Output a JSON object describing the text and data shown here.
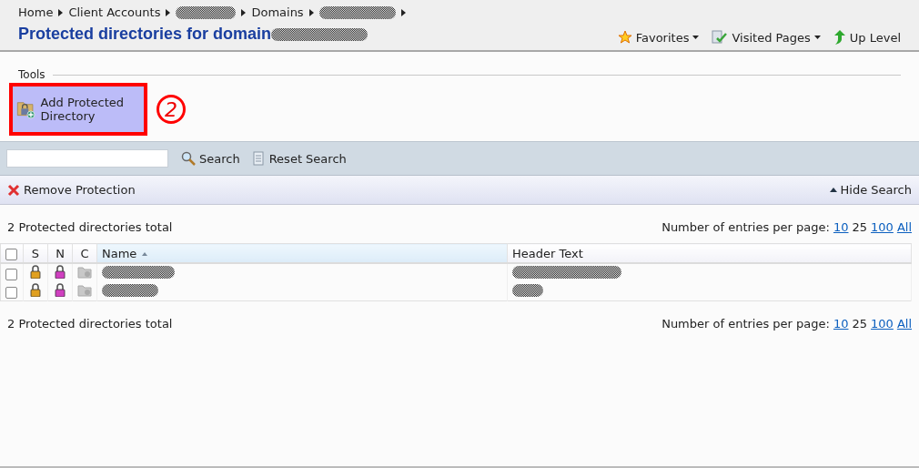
{
  "breadcrumb": [
    {
      "kind": "link",
      "label": "Home"
    },
    {
      "kind": "link",
      "label": "Client Accounts"
    },
    {
      "kind": "redacted"
    },
    {
      "kind": "link",
      "label": "Domains"
    },
    {
      "kind": "redacted"
    }
  ],
  "page_title": "Protected directories for domain",
  "top_links": [
    {
      "label": "Favorites",
      "dropdown": true
    },
    {
      "label": "Visited Pages",
      "dropdown": true
    },
    {
      "label": "Up Level",
      "dropdown": false
    }
  ],
  "tools": {
    "title": "Tools",
    "buttons": [
      {
        "label": "Add Protected Directory",
        "highlighted": true
      }
    ]
  },
  "annotation": {
    "number": "2"
  },
  "search": {
    "buttons": [
      {
        "label": "Search"
      },
      {
        "label": "Reset Search"
      }
    ]
  },
  "actions": {
    "left": [
      {
        "label": "Remove Protection"
      }
    ],
    "right": [
      {
        "label": "Hide Search"
      }
    ]
  },
  "summary": "2 Protected directories total",
  "per_page": {
    "label": "Number of entries per page:",
    "options": [
      {
        "label": "10",
        "selected": false
      },
      {
        "label": "25",
        "selected": true
      },
      {
        "label": "100",
        "selected": false
      },
      {
        "label": "All",
        "selected": false
      }
    ]
  },
  "table": {
    "select_all_checked": false,
    "columns": [
      {
        "label": "S",
        "sorted": false
      },
      {
        "label": "N",
        "sorted": false
      },
      {
        "label": "C",
        "sorted": false
      },
      {
        "label": "Name",
        "sorted": true
      },
      {
        "label": "Header Text",
        "sorted": false
      }
    ],
    "rows": [
      {
        "checked": false
      },
      {
        "checked": false
      }
    ]
  },
  "footer_summary": "2 Protected directories total",
  "footer_per_page": {
    "label": "Number of entries per page:",
    "options": [
      {
        "label": "10",
        "selected": false
      },
      {
        "label": "25",
        "selected": true
      },
      {
        "label": "100",
        "selected": false
      },
      {
        "label": "All",
        "selected": false
      }
    ]
  }
}
